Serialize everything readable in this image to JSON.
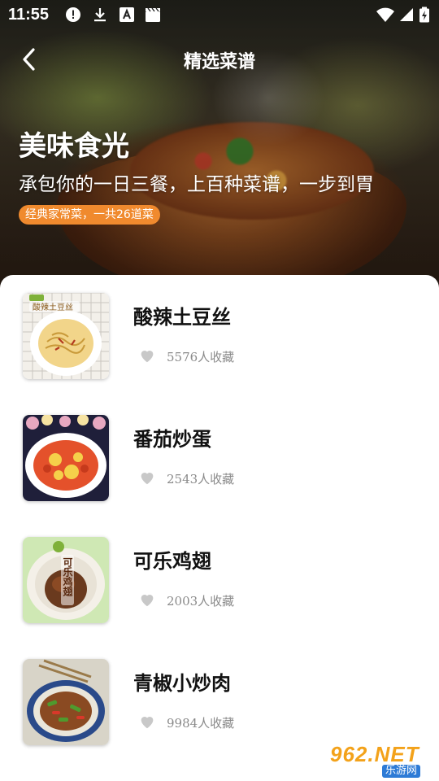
{
  "status_bar": {
    "time": "11:55"
  },
  "nav": {
    "title": "精选菜谱"
  },
  "hero": {
    "title": "美味食光",
    "subtitle": "承包你的一日三餐，上百种菜谱，一步到胃",
    "badge": "经典家常菜，一共26道菜"
  },
  "recipes": [
    {
      "name": "酸辣土豆丝",
      "favorites": "5576人收藏",
      "thumb_text": "酸辣土豆丝"
    },
    {
      "name": "番茄炒蛋",
      "favorites": "2543人收藏",
      "thumb_text": ""
    },
    {
      "name": "可乐鸡翅",
      "favorites": "2003人收藏",
      "thumb_text": "可乐鸡翅"
    },
    {
      "name": "青椒小炒肉",
      "favorites": "9984人收藏",
      "thumb_text": ""
    }
  ],
  "watermark": {
    "main": "962.NET",
    "sub": "乐游网"
  },
  "colors": {
    "badge_bg": "#f08a2e",
    "heart": "#c8c8c8",
    "count_text": "#8a8a8a"
  }
}
